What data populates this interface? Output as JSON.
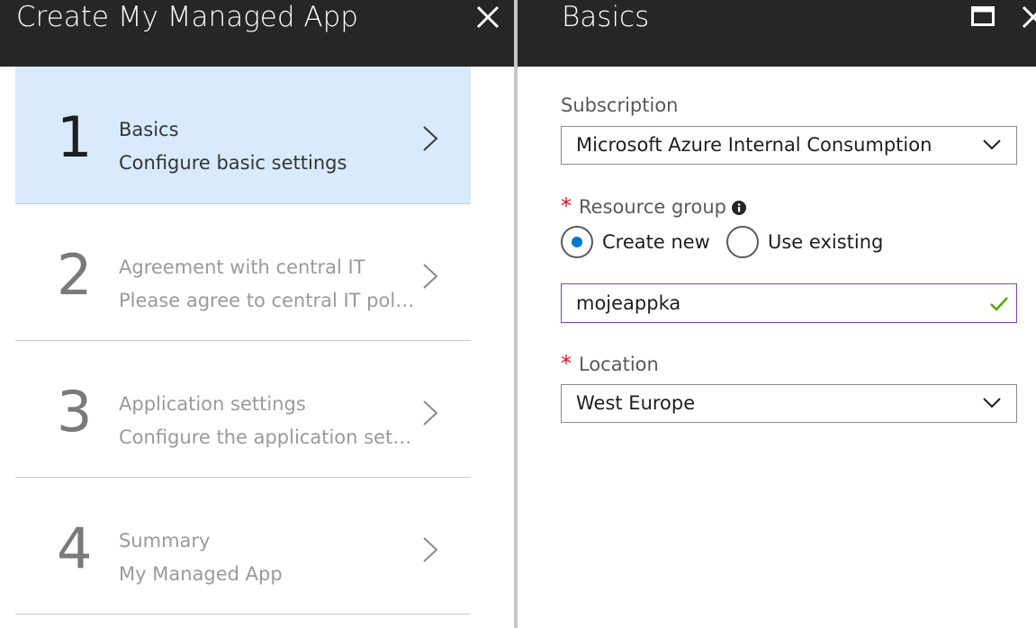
{
  "left_blade": {
    "title": "Create My Managed App",
    "steps": [
      {
        "number": "1",
        "title": "Basics",
        "subtitle": "Configure basic settings",
        "active": true
      },
      {
        "number": "2",
        "title": "Agreement with central IT",
        "subtitle": "Please agree to central IT policy",
        "active": false
      },
      {
        "number": "3",
        "title": "Application settings",
        "subtitle": "Configure the application setti...",
        "active": false
      },
      {
        "number": "4",
        "title": "Summary",
        "subtitle": "My Managed App",
        "active": false
      }
    ]
  },
  "right_blade": {
    "title": "Basics",
    "subscription": {
      "label": "Subscription",
      "value": "Microsoft Azure Internal Consumption"
    },
    "resource_group": {
      "label": "Resource group",
      "required_mark": "*",
      "options": [
        {
          "label": "Create new",
          "selected": true
        },
        {
          "label": "Use existing",
          "selected": false
        }
      ],
      "value": "mojeappka"
    },
    "location": {
      "label": "Location",
      "required_mark": "*",
      "value": "West Europe"
    }
  },
  "colors": {
    "header_bg": "#262626",
    "active_step_bg": "#d8eafc",
    "accent": "#0078d4",
    "required": "#e81123",
    "input_focus_border": "#8b3ab8",
    "valid_check": "#57a300"
  },
  "icons": [
    "close-icon",
    "chevron-right-icon",
    "maximize-icon",
    "chevron-down-icon",
    "info-icon",
    "checkmark-icon"
  ]
}
